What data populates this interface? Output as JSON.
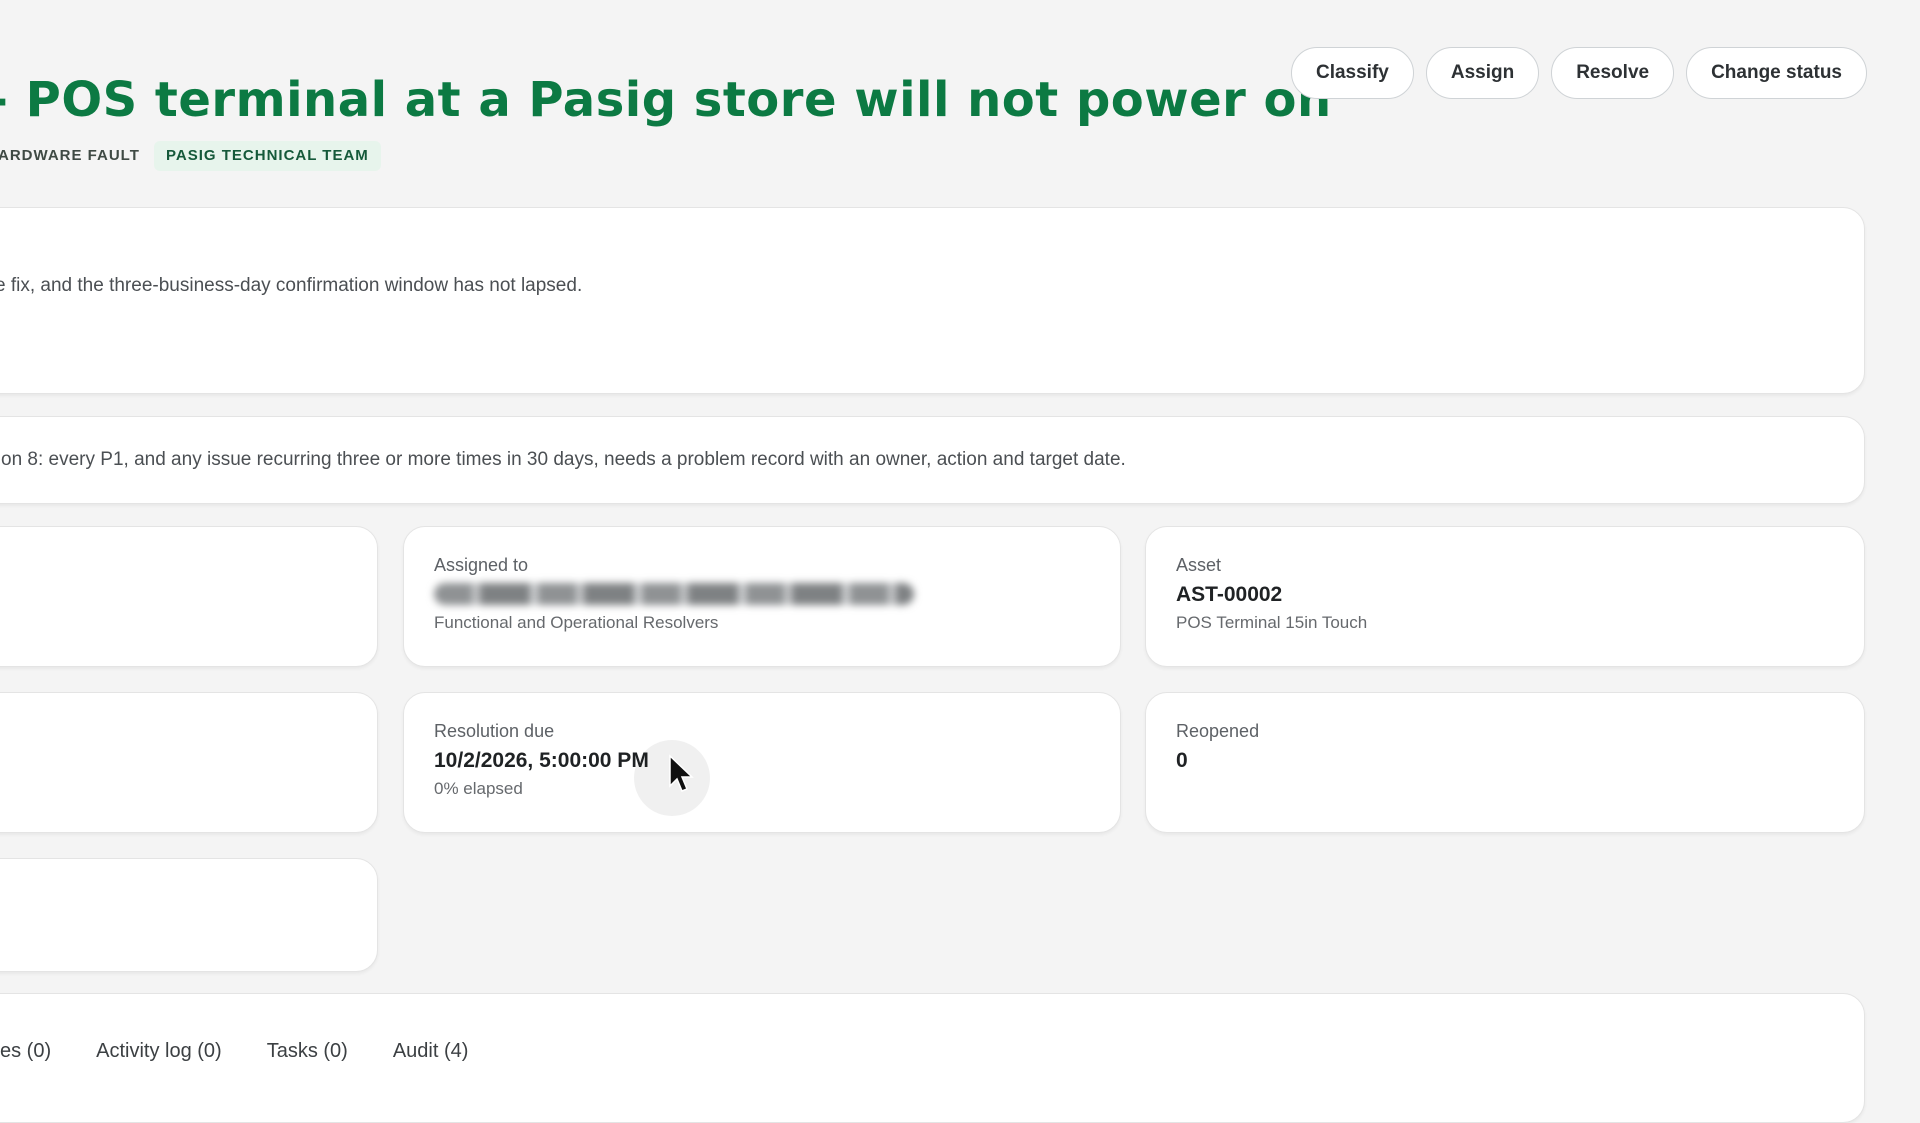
{
  "header": {
    "title": "- POS terminal at a Pasig store will not power on",
    "tags": [
      "ARDWARE FAULT",
      "PASIG TECHNICAL TEAM"
    ]
  },
  "toolbar": {
    "classify_label": "Classify",
    "assign_label": "Assign",
    "resolve_label": "Resolve",
    "change_status_label": "Change status"
  },
  "banners": {
    "confirmation_text": "e fix, and the three-business-day confirmation window has not lapsed.",
    "policy_text": "on 8: every P1, and any issue recurring three or more times in 30 days, needs a problem record with an owner, action and target date."
  },
  "details": {
    "assigned_to": {
      "label": "Assigned to",
      "group": "Functional and Operational Resolvers"
    },
    "asset": {
      "label": "Asset",
      "value": "AST-00002",
      "sub": "POS Terminal 15in Touch"
    },
    "resolution_due": {
      "label": "Resolution due",
      "value": "10/2/2026, 5:00:00 PM",
      "sub": "0% elapsed"
    },
    "reopened": {
      "label": "Reopened",
      "value": "0"
    }
  },
  "tabs": [
    "es (0)",
    "Activity log (0)",
    "Tasks (0)",
    "Audit (4)"
  ],
  "colors": {
    "accent": "#0c7a43",
    "tag_team_bg": "#e7f4ec",
    "page_bg": "#f4f4f4"
  }
}
